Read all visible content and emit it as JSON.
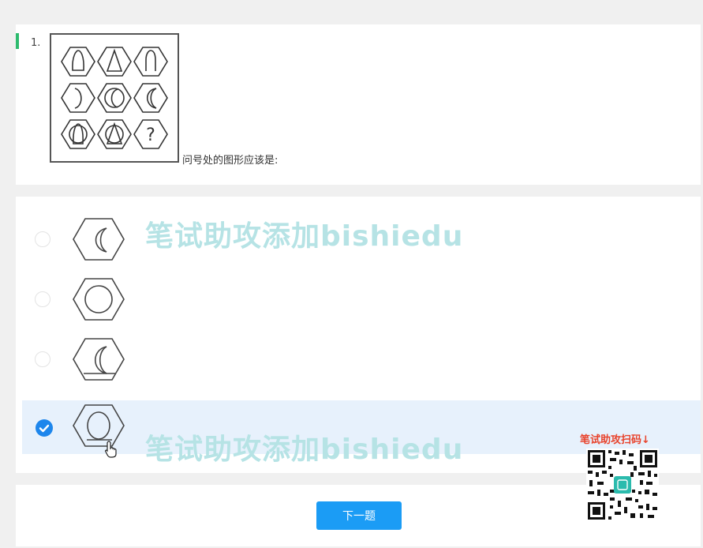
{
  "question": {
    "number": "1.",
    "text": "问号处的图形应该是:",
    "figure_grid": [
      "outline-ogive",
      "outline-triangle",
      "outline-ogive-small",
      "arc-right",
      "ring-crescent",
      "double-crescent",
      "ogive-in-ring",
      "triangle-in-ring",
      "question-mark"
    ],
    "question_mark": "?"
  },
  "options": [
    {
      "figure": "double-crescent-left",
      "selected": false
    },
    {
      "figure": "circle",
      "selected": false
    },
    {
      "figure": "crescent-with-line",
      "selected": false
    },
    {
      "figure": "ring-with-line",
      "selected": true
    }
  ],
  "watermarks": {
    "promo_top": "笔试助攻添加bishiedu",
    "promo_bottom": "笔试助攻添加bishiedu"
  },
  "footer": {
    "next_label": "下一题",
    "scan_label": "笔试助攻扫码↓"
  },
  "colors": {
    "accent": "#1b9cf5",
    "selected_bg": "#e7f1fc",
    "marker": "#2dbb6e",
    "promo": "#b6e3e5",
    "scan_label": "#e8432c"
  },
  "icons": {
    "radio_checked": "check-icon",
    "cursor": "hand-pointer-icon",
    "qr": "qr-code-icon"
  }
}
